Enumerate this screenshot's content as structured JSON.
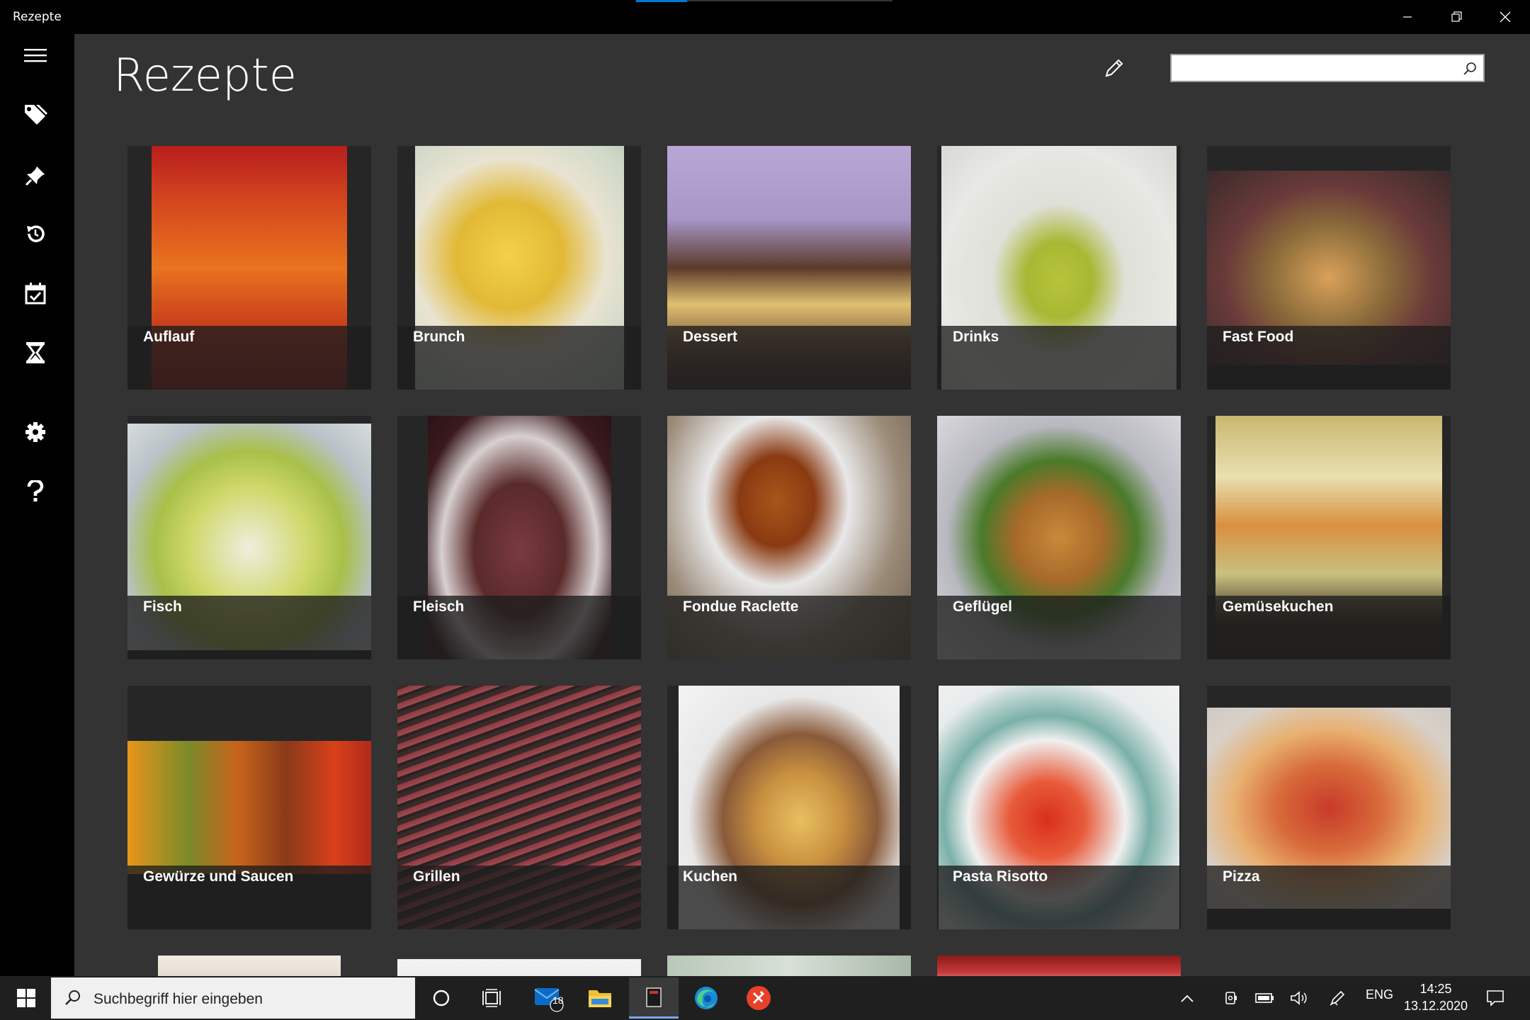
{
  "window": {
    "title": "Rezepte",
    "minimize_icon": "minimize-icon",
    "restore_icon": "restore-icon",
    "close_icon": "close-icon"
  },
  "sidebar": {
    "items": [
      {
        "name": "menu",
        "icon": "hamburger-icon"
      },
      {
        "name": "tags",
        "icon": "tags-icon"
      },
      {
        "name": "pinned",
        "icon": "pin-icon"
      },
      {
        "name": "history",
        "icon": "history-icon"
      },
      {
        "name": "calendar",
        "icon": "calendar-check-icon"
      },
      {
        "name": "timer",
        "icon": "hourglass-icon"
      },
      {
        "name": "settings",
        "icon": "gear-icon"
      },
      {
        "name": "help",
        "icon": "help-icon"
      }
    ]
  },
  "header": {
    "title": "Rezepte",
    "edit_icon": "pencil-icon",
    "search_placeholder": "",
    "search_value": "",
    "search_icon": "search-icon"
  },
  "categories": [
    {
      "label": "Auflauf"
    },
    {
      "label": "Brunch"
    },
    {
      "label": "Dessert"
    },
    {
      "label": "Drinks"
    },
    {
      "label": "Fast Food"
    },
    {
      "label": "Fisch"
    },
    {
      "label": "Fleisch"
    },
    {
      "label": "Fondue Raclette"
    },
    {
      "label": "Geflügel"
    },
    {
      "label": "Gemüsekuchen"
    },
    {
      "label": "Gewürze und Saucen"
    },
    {
      "label": "Grillen"
    },
    {
      "label": "Kuchen"
    },
    {
      "label": "Pasta Risotto"
    },
    {
      "label": "Pizza"
    }
  ],
  "taskbar": {
    "search_placeholder": "Suchbegriff hier eingeben",
    "mail_badge": "18",
    "language": "ENG",
    "time": "14:25",
    "date": "13.12.2020"
  },
  "colors": {
    "main_bg": "#333333",
    "sidebar_bg": "#000000",
    "accent": "#0078d7"
  }
}
